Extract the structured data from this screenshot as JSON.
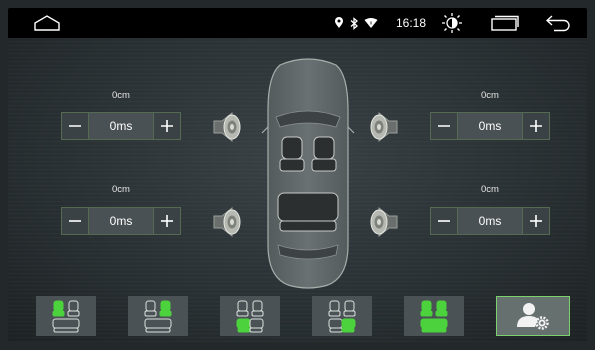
{
  "status_bar": {
    "time": "16:18",
    "icons": [
      "home-icon",
      "location-icon",
      "bluetooth-icon",
      "wifi-icon",
      "brightness-icon",
      "recent-apps-icon",
      "back-icon"
    ]
  },
  "speakers": {
    "front_left": {
      "distance": "0cm",
      "delay": "0ms"
    },
    "front_right": {
      "distance": "0cm",
      "delay": "0ms"
    },
    "rear_left": {
      "distance": "0cm",
      "delay": "0ms"
    },
    "rear_right": {
      "distance": "0cm",
      "delay": "0ms"
    }
  },
  "buttons": {
    "minus": "−",
    "plus": "+"
  },
  "presets": [
    "driver-seat-focus",
    "passenger-seat-focus",
    "rear-left-focus",
    "rear-right-focus",
    "front-seats-focus",
    "custom-settings"
  ],
  "colors": {
    "accent": "#4cd23c",
    "background": "#2a3134",
    "statusbar": "#000000"
  }
}
